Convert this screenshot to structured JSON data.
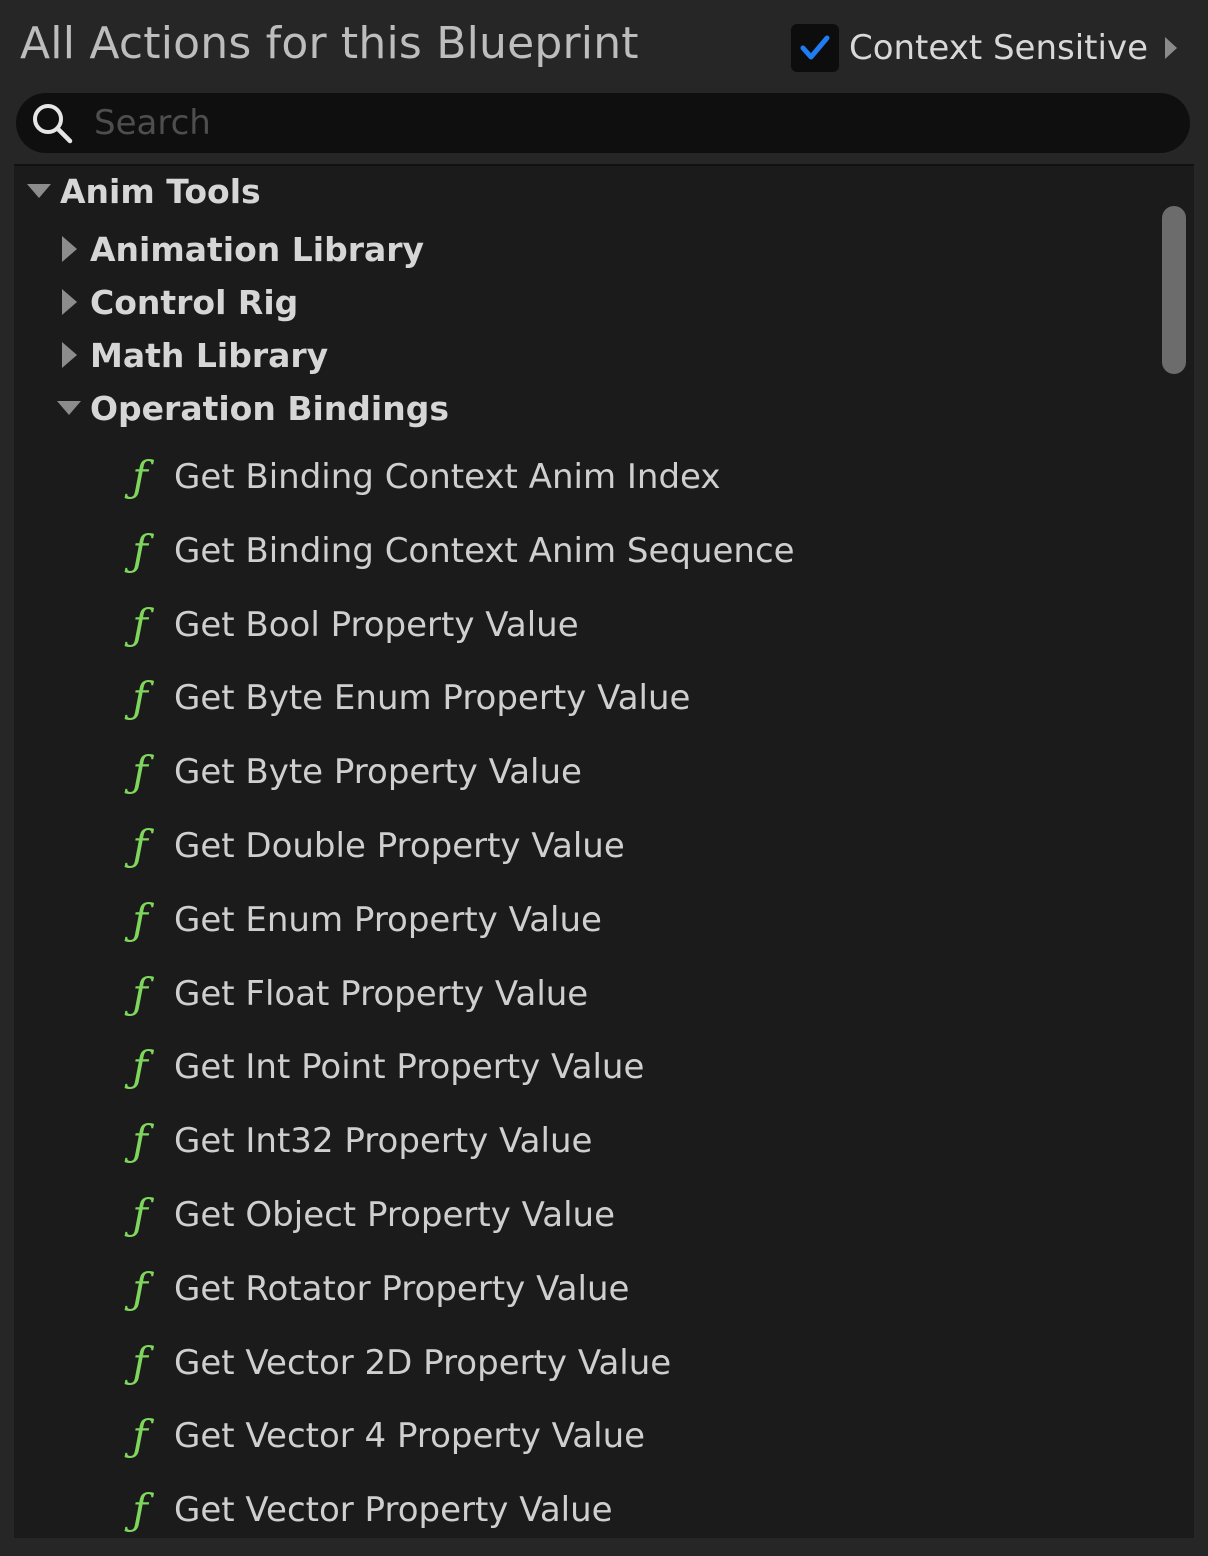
{
  "header": {
    "title": "All Actions for this Blueprint",
    "context_sensitive_label": "Context Sensitive",
    "context_sensitive_checked": true
  },
  "search": {
    "placeholder": "Search",
    "value": ""
  },
  "icons": {
    "function": "ƒ",
    "function_icon_color": "#7fd65c",
    "checkbox_check_color": "#1f7cf2"
  },
  "tree": {
    "root": {
      "label": "Anim Tools",
      "expanded": true
    },
    "categories": [
      {
        "label": "Animation Library",
        "expanded": false
      },
      {
        "label": "Control Rig",
        "expanded": false
      },
      {
        "label": "Math Library",
        "expanded": false
      },
      {
        "label": "Operation Bindings",
        "expanded": true
      }
    ],
    "functions": [
      "Get Binding Context Anim Index",
      "Get Binding Context Anim Sequence",
      "Get Bool Property Value",
      "Get Byte Enum Property Value",
      "Get Byte Property Value",
      "Get Double Property Value",
      "Get Enum Property Value",
      "Get Float Property Value",
      "Get Int Point Property Value",
      "Get Int32 Property Value",
      "Get Object Property Value",
      "Get Rotator Property Value",
      "Get Vector 2D Property Value",
      "Get Vector 4 Property Value",
      "Get Vector Property Value"
    ]
  }
}
